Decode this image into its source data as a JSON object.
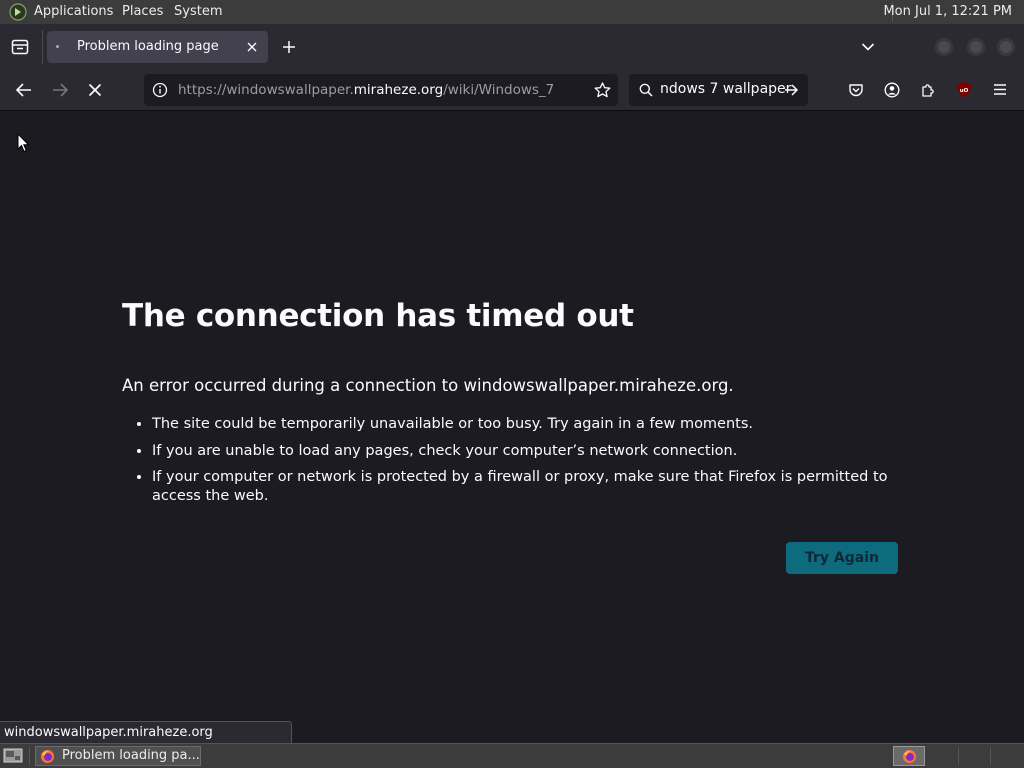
{
  "top_panel": {
    "menus": [
      "Applications",
      "Places",
      "System"
    ],
    "clock": "Mon Jul  1, 12:21 PM"
  },
  "tab": {
    "title": "Problem loading page"
  },
  "url_bar": {
    "prefix": "https://windowswallpaper.",
    "host": "miraheze.org",
    "path": "/wiki/Windows_7"
  },
  "search_bar": {
    "value": "ndows 7 wallpaper"
  },
  "error_page": {
    "title": "The connection has timed out",
    "description": "An error occurred during a connection to windowswallpaper.miraheze.org.",
    "bullets": [
      "The site could be temporarily unavailable or too busy. Try again in a few moments.",
      "If you are unable to load any pages, check your computer’s network connection.",
      "If your computer or network is protected by a firewall or proxy, make sure that Firefox is permitted to access the web."
    ],
    "try_again_label": "Try Again"
  },
  "status_bar": {
    "text": "windowswallpaper.miraheze.org"
  },
  "taskbar": {
    "window_label": "Problem loading pa..."
  },
  "colors": {
    "content_bg": "#1c1b22",
    "toolbar_bg": "#2b2a33",
    "button_bg": "#0e6a7d",
    "panel_bg": "#3c3c3c"
  }
}
